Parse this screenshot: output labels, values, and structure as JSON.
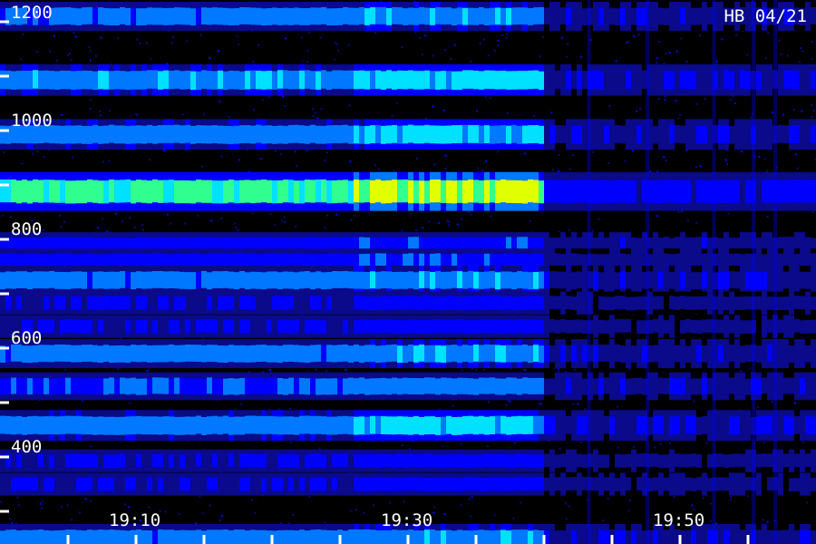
{
  "chart_data": {
    "type": "heatmap",
    "title": "",
    "xlabel": "",
    "ylabel": "",
    "annotation": "HB 04/21",
    "y_tick_labels": [
      "1200",
      "1000",
      "800",
      "600",
      "400"
    ],
    "x_tick_labels": [
      "19:10",
      "19:30",
      "19:50"
    ],
    "y_minor_ticks": [
      1100,
      900,
      700,
      500,
      300
    ],
    "ylim": [
      240,
      1240
    ],
    "xlim_minutes": [
      0,
      60
    ],
    "x_tick_minutes": [
      5,
      10,
      15,
      20,
      25,
      30,
      35,
      40,
      45,
      50,
      55
    ],
    "colormap": [
      "#000000",
      "#0a0a8a",
      "#0000ff",
      "#0078ff",
      "#00e0ff",
      "#30ff90",
      "#e0ff00"
    ],
    "segments": [
      {
        "from": 0,
        "to": 26,
        "gain": 0.85
      },
      {
        "from": 26,
        "to": 39.7,
        "gain": 1.0
      },
      {
        "from": 39.7,
        "to": 60,
        "gain": 0.25
      }
    ],
    "bursts_minutes": [
      43.3,
      47.6,
      52.5,
      55.4,
      57.0
    ],
    "bands": [
      {
        "y": 1210,
        "intensity": 0.55
      },
      {
        "y": 1093,
        "intensity": 0.65
      },
      {
        "y": 993,
        "intensity": 0.62
      },
      {
        "y": 888,
        "intensity": 0.95
      },
      {
        "y": 790,
        "intensity": 0.4
      },
      {
        "y": 760,
        "intensity": 0.4
      },
      {
        "y": 725,
        "intensity": 0.55
      },
      {
        "y": 683,
        "intensity": 0.3
      },
      {
        "y": 640,
        "intensity": 0.3
      },
      {
        "y": 590,
        "intensity": 0.55
      },
      {
        "y": 530,
        "intensity": 0.5
      },
      {
        "y": 458,
        "intensity": 0.62
      },
      {
        "y": 393,
        "intensity": 0.3
      },
      {
        "y": 350,
        "intensity": 0.3
      },
      {
        "y": 250,
        "intensity": 0.55
      }
    ]
  }
}
